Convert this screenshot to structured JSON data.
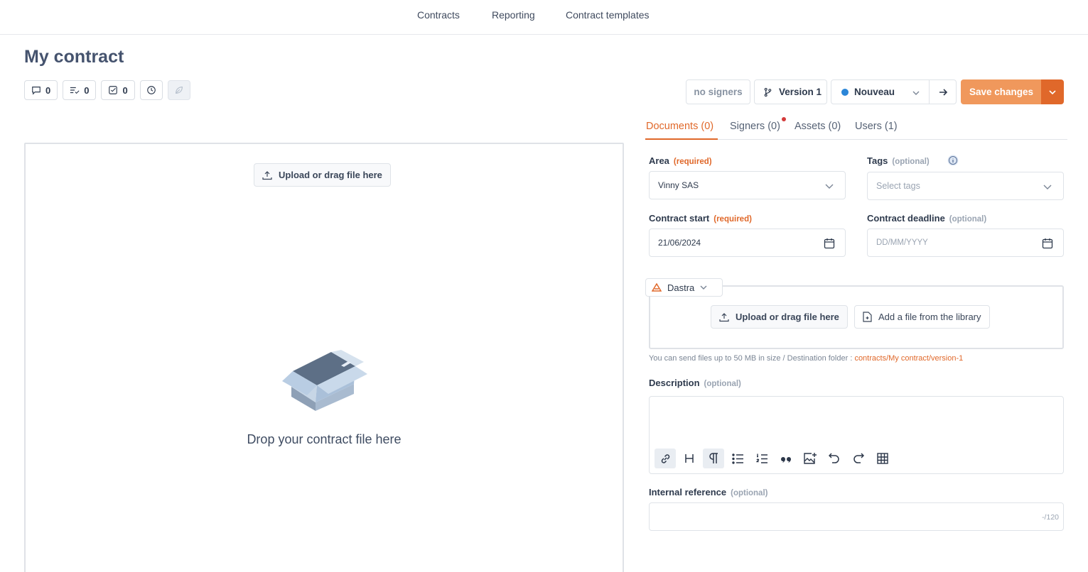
{
  "nav": {
    "contracts": "Contracts",
    "reporting": "Reporting",
    "templates": "Contract templates"
  },
  "page": {
    "title": "My contract"
  },
  "counters": {
    "comments": "0",
    "tasks": "0",
    "checks": "0"
  },
  "actions": {
    "signers": "no signers",
    "version": "Version 1",
    "status": "Nouveau",
    "status_color": "#2b86d8",
    "save": "Save changes",
    "accent": "#e0682a",
    "save_color": "#f0985c"
  },
  "tabs": [
    {
      "label": "Documents (0)"
    },
    {
      "label": "Signers (0)"
    },
    {
      "label": "Assets (0)"
    },
    {
      "label": "Users (1)"
    }
  ],
  "form": {
    "area_label": "Area",
    "required": "(required)",
    "optional": "(optional)",
    "area_value": "Vinny SAS",
    "tags_label": "Tags",
    "tags_placeholder": "Select tags",
    "start_label": "Contract start",
    "start_value": "21/06/2024",
    "deadline_label": "Contract deadline",
    "deadline_placeholder": "DD/MM/YYYY",
    "source": "Dastra",
    "upload": "Upload or drag file here",
    "library": "Add a file from the library",
    "hint": "You can send files up to 50 MB in size / Destination folder : ",
    "folder": "contracts/My contract/version-1",
    "description_label": "Description",
    "internal_label": "Internal reference",
    "counter": "-/120"
  },
  "drop": {
    "upload": "Upload or drag file here",
    "message": "Drop your contract file here"
  }
}
